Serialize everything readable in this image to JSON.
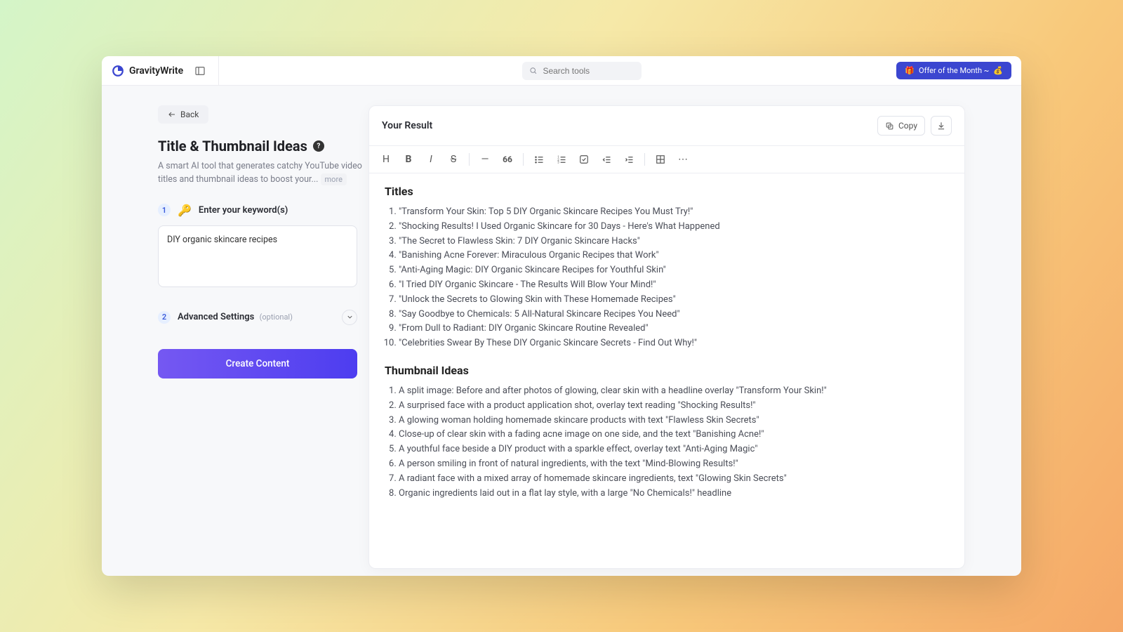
{
  "brand": {
    "name": "GravityWrite"
  },
  "search": {
    "placeholder": "Search tools"
  },
  "offer": {
    "label": "Offer of the Month ~",
    "emoji": "💰"
  },
  "back": {
    "label": "Back"
  },
  "page": {
    "title": "Title & Thumbnail Ideas",
    "desc": "A smart AI tool that generates catchy YouTube video titles and thumbnail ideas to boost your...",
    "more": "more"
  },
  "step1": {
    "num": "1",
    "emoji": "🔑",
    "label": "Enter your keyword(s)",
    "value": "DIY organic skincare recipes"
  },
  "step2": {
    "num": "2",
    "label": "Advanced Settings",
    "optional": "(optional)"
  },
  "create": {
    "label": "Create Content"
  },
  "result": {
    "title": "Your Result",
    "copy": "Copy",
    "section_titles": "Titles",
    "section_thumbs": "Thumbnail Ideas",
    "titles": [
      "\"Transform Your Skin: Top 5 DIY Organic Skincare Recipes You Must Try!\"",
      "\"Shocking Results! I Used Organic Skincare for 30 Days - Here's What Happened",
      "\"The Secret to Flawless Skin: 7 DIY Organic Skincare Hacks\"",
      "\"Banishing Acne Forever: Miraculous Organic Recipes that Work\"",
      "\"Anti-Aging Magic: DIY Organic Skincare Recipes for Youthful Skin\"",
      "\"I Tried DIY Organic Skincare - The Results Will Blow Your Mind!\"",
      "\"Unlock the Secrets to Glowing Skin with These Homemade Recipes\"",
      "\"Say Goodbye to Chemicals: 5 All-Natural Skincare Recipes You Need\"",
      "\"From Dull to Radiant: DIY Organic Skincare Routine Revealed\"",
      "\"Celebrities Swear By These DIY Organic Skincare Secrets - Find Out Why!\""
    ],
    "thumbs": [
      "A split image: Before and after photos of glowing, clear skin with a headline overlay \"Transform Your Skin!\"",
      "A surprised face with a product application shot, overlay text reading \"Shocking Results!\"",
      "A glowing woman holding homemade skincare products with text \"Flawless Skin Secrets\"",
      "Close-up of clear skin with a fading acne image on one side, and the text \"Banishing Acne!\"",
      "A youthful face beside a DIY product with a sparkle effect, overlay text \"Anti-Aging Magic\"",
      "A person smiling in front of natural ingredients, with the text \"Mind-Blowing Results!\"",
      "A radiant face with a mixed array of homemade skincare ingredients, text \"Glowing Skin Secrets\"",
      "Organic ingredients laid out in a flat lay style, with a large \"No Chemicals!\" headline"
    ]
  }
}
